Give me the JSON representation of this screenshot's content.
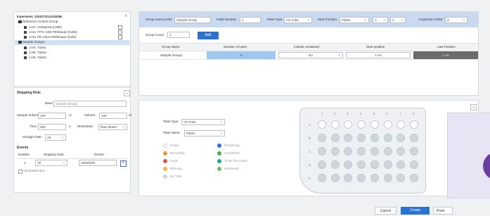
{
  "tree": {
    "root": "Experiment_20240731141018380",
    "collapse_icon": "-I",
    "groups": [
      {
        "label": "Reference Control Group",
        "items": [
          {
            "id": "1-H1",
            "name": "Unstained (Cells)"
          },
          {
            "id": "1-H2",
            "name": "FITC CD3 PE/Mouse (Cells)"
          },
          {
            "id": "1-H3",
            "name": "PE CD14 PE/Mouse (Cells)"
          }
        ]
      },
      {
        "label": "Sample Group1",
        "items": [
          {
            "id": "1-H4",
            "name": "Tube1"
          },
          {
            "id": "1-H5",
            "name": "Tube2"
          },
          {
            "id": "1-H6",
            "name": "Tube3"
          }
        ]
      }
    ]
  },
  "stopping": {
    "title": "Stopping Rule",
    "name_label": "Base:",
    "name_value": "Sample Group1",
    "sample_volume_label": "Sample Volume:",
    "sample_volume_value": "100",
    "sample_volume_unit": "ul",
    "volume_label": "Volume:",
    "volume_value": "100",
    "volume_unit": "ul",
    "time_label": "Time:",
    "time_value": "300",
    "time_unit": "s",
    "worksheet_label": "Worksheet:",
    "worksheet_value": "Raw Works",
    "storage_gate_label": "Storage Gate:",
    "storage_gate_value": "All",
    "events_title": "Events",
    "table_headers": [
      "Number",
      "Stopping Gate",
      "Events"
    ],
    "row": {
      "number": "1",
      "gate": "All",
      "events": "10000000"
    },
    "add_icon": "+",
    "checkbox_label": "Volume&Count"
  },
  "config": {
    "prefix_label": "Group name prefix:",
    "prefix_value": "Sample Group",
    "initial_label": "Initial Number:",
    "initial_value": "1",
    "plate_type_label": "Plate Type:",
    "plate_type_value": "AS-Tube",
    "start_position_label": "Start Position:",
    "start_position_value": "Plate1",
    "start_row": "A",
    "start_col": "3",
    "acq_order_label": "Acquisition Order:",
    "acq_order_value": "Z",
    "group_count_label": "Group Count:",
    "group_count_value": "1",
    "add_button": "Add"
  },
  "group_table": {
    "headers": [
      "Group Name",
      "Number of tubes",
      "Include Unstained",
      "Start position",
      "Last Position"
    ],
    "row": {
      "name": "Sample Group1",
      "tubes": "3",
      "unstained": "No",
      "start": "1-A3",
      "last": "1-A5"
    }
  },
  "plate_panel": {
    "plate_type_label": "Plate Type:",
    "plate_type_value": "AS-Tube",
    "plate_name_label": "Plate Name:",
    "plate_name_value": "Plate1",
    "legend_left": [
      "Empty",
      "Recording",
      "Fault",
      "Warning",
      "No Tube"
    ],
    "legend_right": [
      "Pendening",
      "Completed",
      "To Be Recorded",
      "Unstained"
    ],
    "cols": [
      "1",
      "2",
      "3",
      "4",
      "5",
      "6",
      "7",
      "8"
    ],
    "rows": [
      "A",
      "B",
      "C",
      "D",
      "E"
    ],
    "collapse_icon": "chevron-down-icon"
  },
  "footer": {
    "cancel": "Cancel",
    "create": "Create",
    "preview": "Previ"
  },
  "colors": {
    "accent": "#2b73d1",
    "header_bar": "#c9d9ef",
    "selected_row": "#cfe0f5",
    "tube_cell": "#9ec8f0",
    "last_cell": "#6b6b6b",
    "well_empty": "#dfe3e8",
    "well_record": "#cfd5dc",
    "legend_recording": "#e69a3a",
    "legend_fault": "#d9534f",
    "legend_warning": "#f2b640",
    "legend_notube": "#cdd2d8",
    "legend_pending": "#2b73d1",
    "legend_completed": "#4caf50",
    "legend_tobe": "#1aa7a0",
    "legend_unstained": "#7cba5e"
  }
}
